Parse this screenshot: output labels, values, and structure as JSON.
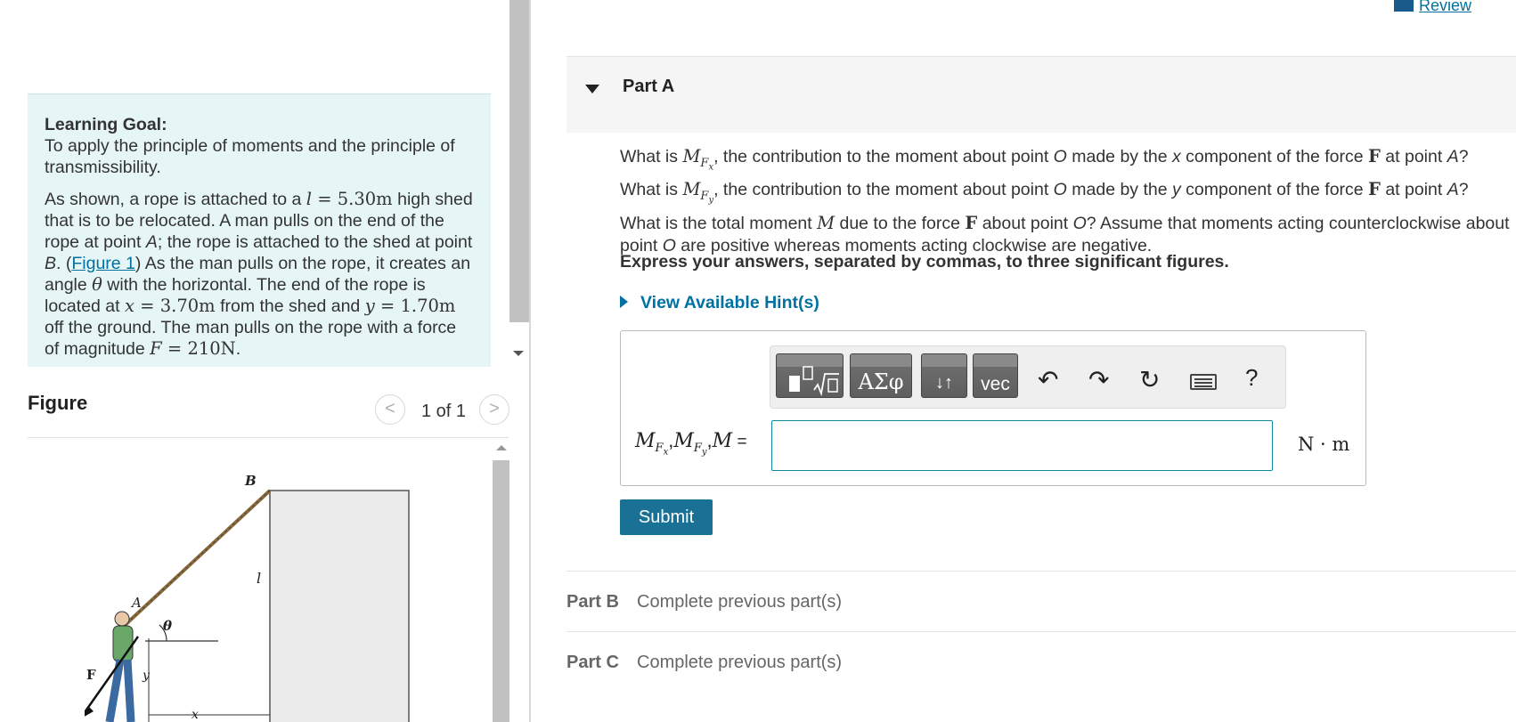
{
  "review": {
    "label": "Review",
    "icon": "book-icon"
  },
  "learning_goal": {
    "title": "Learning Goal:",
    "goal_text": "To apply the principle of moments and the principle of transmissibility.",
    "p1": "As shown, a rope is attached to a",
    "l_var": "l",
    "l_eq": " = ",
    "l_val": "5.30m",
    "p2": " high shed that is to be relocated. A man pulls on the end of the rope at point ",
    "point_a": "A",
    "p3": "; the rope is attached to the shed at point ",
    "point_b": "B",
    "p4": ". (",
    "figure_link": "Figure 1",
    "p5": ") As the man pulls on the rope, it creates an angle ",
    "theta": "θ",
    "p6": " with the horizontal. The end of the rope is located at ",
    "x_var": "x",
    "x_val": "3.70m",
    "p7": " from the shed and ",
    "y_var": "y",
    "y_val": "1.70m",
    "p8": " off the ground. The man pulls on the rope with a force of magnitude ",
    "f_var": "F",
    "f_val": "210N",
    "p9": "."
  },
  "figure": {
    "title": "Figure",
    "counter": "1 of 1",
    "prev": "<",
    "next": ">",
    "labels": {
      "B": "B",
      "l": "l",
      "A": "A",
      "theta": "θ",
      "F": "F",
      "y": "y",
      "x": "x"
    }
  },
  "part_a": {
    "title": "Part A",
    "q1_pre": "What is ",
    "q1_post": ", the contribution to the moment about point ",
    "q_o": "O",
    "q1_mid": " made by the ",
    "q1_x": "x",
    "q_comp": " component of the force ",
    "q_F": "F",
    "q_at": " at point ",
    "q_a": "A",
    "q_qm": "?",
    "q2_y": "y",
    "q3_pre": "What is the total moment ",
    "q3_M": "M",
    "q3_mid": " due to the force ",
    "q3_post": " about point ",
    "q3_tail": "? Assume that moments acting counterclockwise about point ",
    "q3_end": " are positive whereas moments acting clockwise are negative.",
    "M_sym": "M",
    "F_sub": "F",
    "x_sub": "x",
    "y_sub": "y",
    "instructions": "Express your answers, separated by commas, to three significant figures.",
    "hint": "View Available Hint(s)",
    "answer_label_eq": " =",
    "comma": ",",
    "answer_value": "",
    "unit": "N · m",
    "submit": "Submit"
  },
  "toolbar": {
    "greek": "ΑΣφ",
    "arrows": "↓↑",
    "vec": "vec",
    "help": "?",
    "icons": [
      "template-icon",
      "greek-icon",
      "arrows-icon",
      "vec-icon",
      "undo-icon",
      "redo-icon",
      "reset-icon",
      "keyboard-icon",
      "help-icon"
    ]
  },
  "part_b": {
    "label": "Part B",
    "status": "Complete previous part(s)"
  },
  "part_c": {
    "label": "Part C",
    "status": "Complete previous part(s)"
  },
  "colors": {
    "accent": "#0071a0",
    "submit": "#1a7196",
    "goal_bg": "#e6f5f6",
    "input_border": "#0e89a0"
  }
}
